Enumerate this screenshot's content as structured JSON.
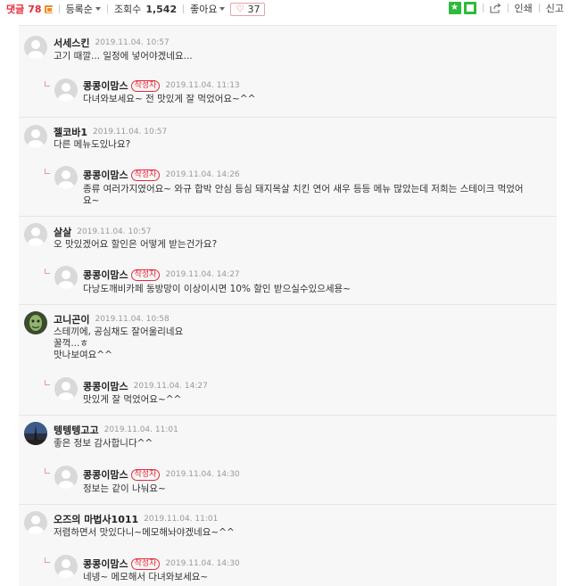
{
  "toolbar": {
    "comments_label": "댓글",
    "comments_count": "78",
    "sort_label": "등록순",
    "views_label": "조회수",
    "views_count": "1,542",
    "likes_label": "좋아요",
    "likes_count": "37",
    "print_label": "인쇄",
    "report_label": "신고",
    "accent_color": "#e8293a",
    "green_icon_color": "#2dbb3a",
    "icons": [
      "comment-badge-icon",
      "caret-down-icon",
      "heart-icon",
      "star-icon",
      "square-icon",
      "share-icon"
    ]
  },
  "comments": [
    {
      "name": "서세스킨",
      "date": "2019.11.04. 10:57",
      "text": "고기 때깔... 일정에 넣어야겠네요...",
      "reply": {
        "name": "콩콩이맘스",
        "badge": "작성자",
        "date": "2019.11.04. 11:13",
        "text": "다녀와보세요~ 전 맛있게 잘 먹었어요~^^"
      }
    },
    {
      "name": "젤코바1",
      "date": "2019.11.04. 10:57",
      "text": "다른 메뉴도있나요?",
      "reply": {
        "name": "콩콩이맘스",
        "badge": "작성자",
        "date": "2019.11.04. 14:26",
        "text": "종류 여러가지였어요~ 와규 합박 안심 등심 돼지목살 치킨 연어 새우 등등 메뉴 많았는데 저희는 스테이크 먹었어\n요~"
      }
    },
    {
      "name": "살살",
      "date": "2019.11.04. 10:57",
      "text": "오 맛있겠어요 할인은 어떻게 받는건가요?",
      "reply": {
        "name": "콩콩이맘스",
        "badge": "작성자",
        "date": "2019.11.04. 14:27",
        "text": "다낭도깨비카페 동방망이 이상이시면 10% 할인 받으실수있으세용~"
      }
    },
    {
      "name": "고니곤이",
      "date": "2019.11.04. 10:58",
      "text": "스테끼에, 공심채도 잘어울리네요\n꿀꺽...ㅎ\n맛나보여요^^",
      "reply": {
        "name": "콩콩이맘스",
        "badge": "작성자",
        "date": "2019.11.04. 14:27",
        "text": "맛있게 잘 먹었어요~^^"
      }
    },
    {
      "name": "텡텡텡고고",
      "date": "2019.11.04. 11:01",
      "text": "좋은 정보 감사합니다^^",
      "reply": {
        "name": "콩콩이맘스",
        "badge": "작성자",
        "date": "2019.11.04. 14:30",
        "text": "정보는 같이 나눠요~"
      }
    },
    {
      "name": "오즈의 마법사1011",
      "date": "2019.11.04. 11:01",
      "text": "저렴하면서 맛있다니~메모해놔야겠네요~^^",
      "reply": {
        "name": "콩콩이맘스",
        "badge": "작성자",
        "date": "2019.11.04. 14:30",
        "text": "네넹~ 메모해서 다녀와보세요~"
      }
    }
  ]
}
